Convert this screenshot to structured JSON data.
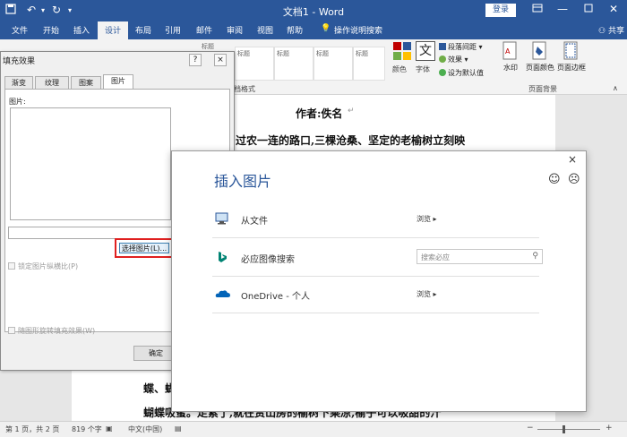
{
  "titlebar": {
    "doc_title": "文档1 - Word",
    "login": "登录",
    "restore_icon": "ribbon-restore-icon"
  },
  "tabs": [
    {
      "label": "文件"
    },
    {
      "label": "开始"
    },
    {
      "label": "插入"
    },
    {
      "label": "设计",
      "active": true
    },
    {
      "label": "布局"
    },
    {
      "label": "引用"
    },
    {
      "label": "邮件"
    },
    {
      "label": "审阅"
    },
    {
      "label": "视图"
    },
    {
      "label": "帮助"
    },
    {
      "label": "操作说明搜索"
    }
  ],
  "share_label": "共享",
  "ribbon": {
    "style_gallery": [
      "标题",
      "标题",
      "标题",
      "标题",
      "标题",
      "标题",
      "标题"
    ],
    "doc_format_label": "文档格式",
    "colors_label": "颜色",
    "fonts_label": "字体",
    "font_glyph": "文",
    "para_spacing_label": "段落间距",
    "effects_label": "效果",
    "set_default_label": "设为默认值",
    "watermark_label": "水印",
    "page_color_label": "页面颜色",
    "page_border_label": "页面边框",
    "page_bg_group": "页面背景"
  },
  "document": {
    "author_line": "作者:佚名",
    "line2": "过农一连的路口,三棵沧桑、坚定的老榆树立刻映",
    "line3": "蝶、蝴",
    "line4": "蝴蝶吸蜜。走累了,就在赏山房的榆树下乘凉,榆子可以吸甜的汁"
  },
  "statusbar": {
    "page": "第 1 页，共 2 页",
    "words": "819 个字",
    "lang": "中文(中国)",
    "zoom_minus": "−",
    "zoom_plus": "+"
  },
  "fill_dialog": {
    "title": "填充效果",
    "help": "?",
    "close": "×",
    "tabs": [
      "渐变",
      "纹理",
      "图案",
      "图片"
    ],
    "active_tab": 3,
    "picture_label": "图片:",
    "select_button": "选择图片(L)...",
    "lock_ratio": "锁定图片纵横比(P)",
    "rotate_with_shape": "随图形旋转填充效果(W)",
    "ok": "确定"
  },
  "insert_dialog": {
    "title": "插入图片",
    "close": "×",
    "rows": [
      {
        "label": "从文件",
        "action": "浏览"
      },
      {
        "label": "必应图像搜索",
        "placeholder": "搜索必应"
      },
      {
        "label": "OneDrive - 个人",
        "action": "浏览"
      }
    ]
  },
  "colors": {
    "word_blue": "#2b579a",
    "highlight_red": "#e02020",
    "bing_teal": "#008373",
    "onedrive_blue": "#0364b8"
  }
}
